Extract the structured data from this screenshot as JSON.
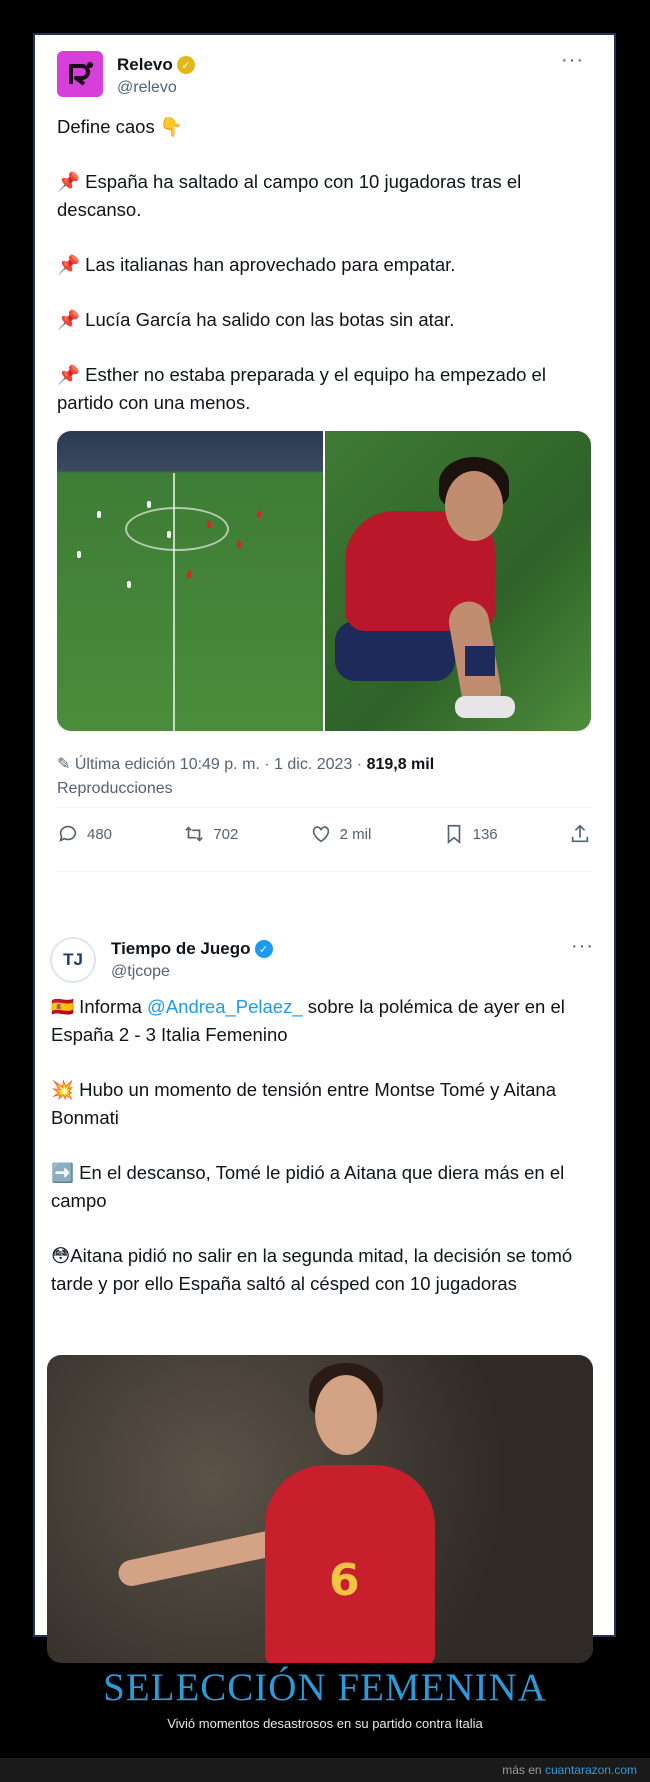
{
  "tweet1": {
    "name": "Relevo",
    "handle": "@relevo",
    "more": "···",
    "paragraphs": [
      "Define caos 👇",
      "📌 España ha saltado al campo con 10 jugadoras tras el descanso.",
      "📌 Las italianas han aprovechado para empatar.",
      "📌 Lucía García ha salido con las botas sin atar.",
      "📌 Esther no estaba preparada y el equipo ha empezado el partido con una menos."
    ],
    "edit_text": "Última edición 10:49 p. m. · 1 dic. 2023 · ",
    "views": "819,8 mil",
    "views_label": "Reproducciones",
    "actions": {
      "replies": "480",
      "retweets": "702",
      "likes": "2 mil",
      "bookmarks": "136"
    },
    "colors": {
      "avatar": "#d63fd9",
      "verified": "#e2b719"
    }
  },
  "tweet2": {
    "name": "Tiempo de Juego",
    "handle": "@tjcope",
    "more": "···",
    "p1_prefix": "🇪🇸 Informa ",
    "p1_mention": "@Andrea_Pelaez_",
    "p1_suffix": " sobre la polémica de ayer en el España 2 - 3 Italia Femenino",
    "p2": "💥 Hubo un momento de tensión entre Montse Tomé y Aitana Bonmati",
    "p3": "➡️ En el descanso, Tomé le pidió a Aitana que diera más en el campo",
    "p4": "😳Aitana pidió no salir en la segunda mitad, la decisión se tomó tarde y por ello España saltó al césped con 10 jugadoras",
    "avatar_text": "TJ",
    "jersey_number": "6",
    "colors": {
      "verified": "#1d9bf0",
      "mention": "#1d9bf0"
    }
  },
  "footer": {
    "title": "SELECCIÓN FEMENINA",
    "subtitle": "Vivió momentos desastrosos en su partido contra Italia",
    "credit_prefix": "más en ",
    "credit_link": "cuantarazon.com"
  }
}
